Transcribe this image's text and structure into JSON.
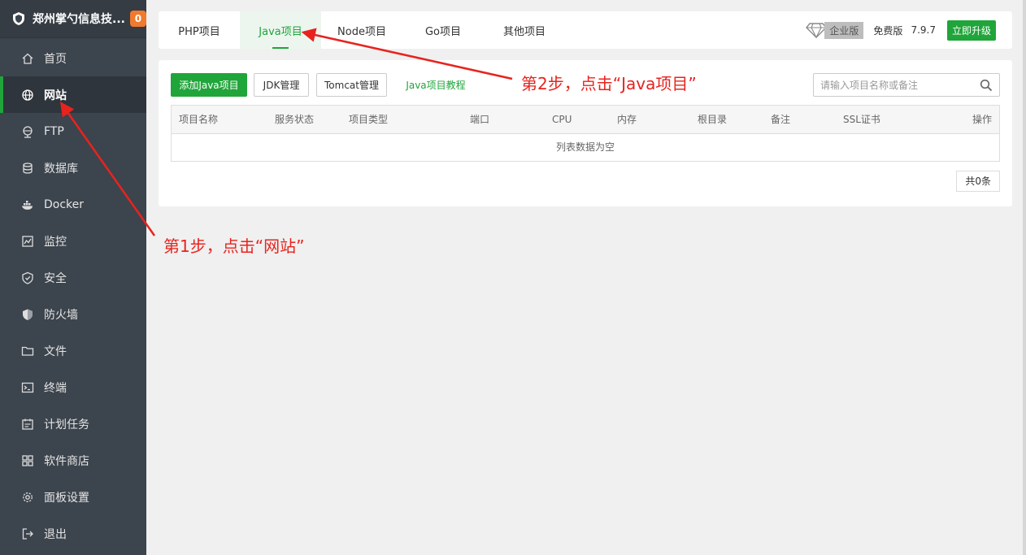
{
  "brand": {
    "name": "郑州掌勺信息技...",
    "badge": "0"
  },
  "sidebar": {
    "items": [
      {
        "label": "首页",
        "icon": "home-icon"
      },
      {
        "label": "网站",
        "icon": "globe-icon",
        "active": true
      },
      {
        "label": "FTP",
        "icon": "ftp-icon"
      },
      {
        "label": "数据库",
        "icon": "database-icon"
      },
      {
        "label": "Docker",
        "icon": "docker-icon"
      },
      {
        "label": "监控",
        "icon": "monitor-icon"
      },
      {
        "label": "安全",
        "icon": "shield-check-icon"
      },
      {
        "label": "防火墙",
        "icon": "firewall-icon"
      },
      {
        "label": "文件",
        "icon": "folder-icon"
      },
      {
        "label": "终端",
        "icon": "terminal-icon"
      },
      {
        "label": "计划任务",
        "icon": "calendar-icon"
      },
      {
        "label": "软件商店",
        "icon": "grid-icon"
      },
      {
        "label": "面板设置",
        "icon": "gear-icon"
      },
      {
        "label": "退出",
        "icon": "logout-icon"
      }
    ]
  },
  "tabs": [
    {
      "label": "PHP项目"
    },
    {
      "label": "Java项目",
      "active": true
    },
    {
      "label": "Node项目"
    },
    {
      "label": "Go项目"
    },
    {
      "label": "其他项目"
    }
  ],
  "version": {
    "edition": "企业版",
    "free": "免费版",
    "number": "7.9.7",
    "upgrade": "立即升级"
  },
  "toolbar": {
    "add": "添加Java项目",
    "jdk": "JDK管理",
    "tomcat": "Tomcat管理",
    "tutorial": "Java项目教程"
  },
  "search": {
    "placeholder": "请输入项目名称或备注"
  },
  "table": {
    "columns": [
      "项目名称",
      "服务状态",
      "项目类型",
      "端口",
      "CPU",
      "内存",
      "根目录",
      "备注",
      "SSL证书",
      "操作"
    ],
    "empty": "列表数据为空"
  },
  "pager": {
    "total": "共0条"
  },
  "annotations": {
    "step1": "第1步，点击“网站”",
    "step2": "第2步，点击“Java项目”"
  },
  "colors": {
    "accent": "#20a53a",
    "sidebar": "#3c444d",
    "annotation": "#e8231e",
    "badge": "#f07a2e"
  }
}
